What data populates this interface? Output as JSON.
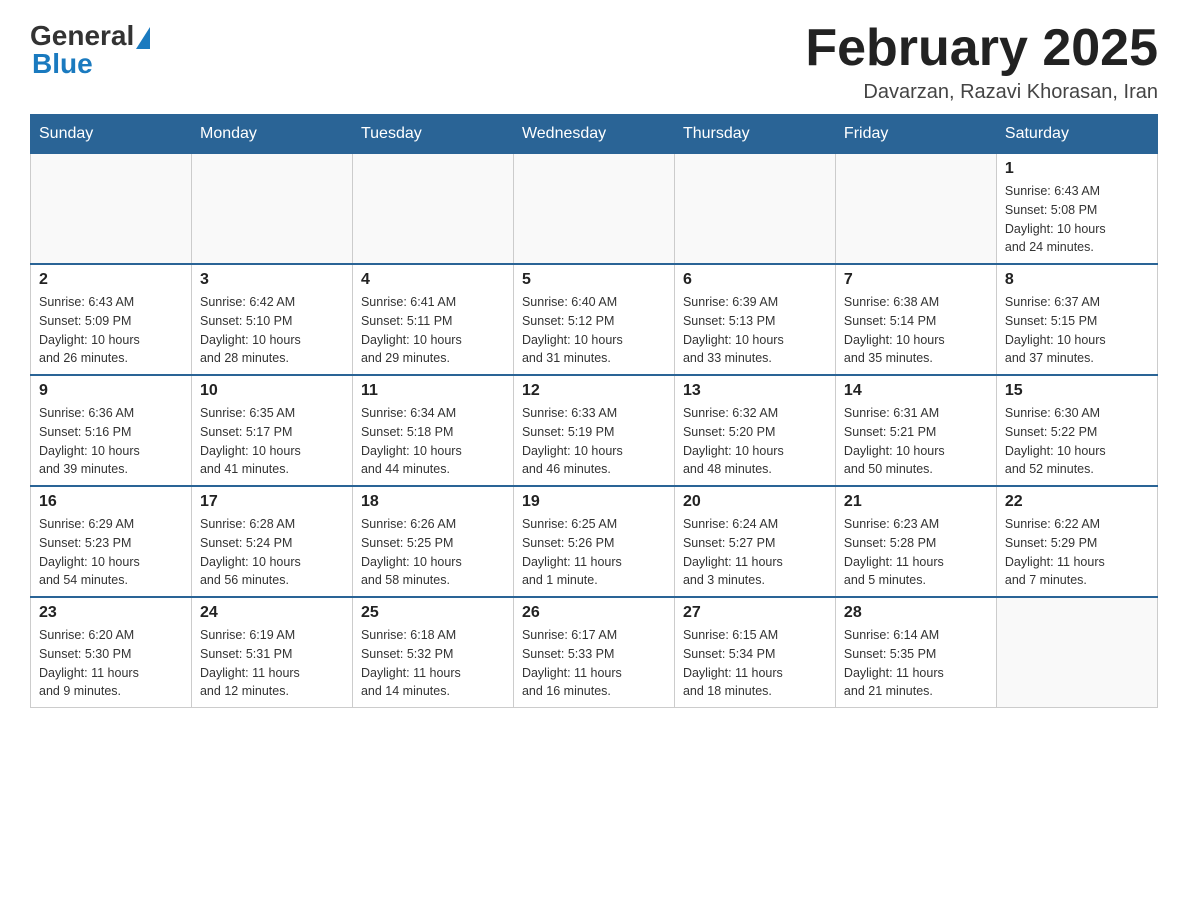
{
  "logo": {
    "general": "General",
    "blue": "Blue"
  },
  "header": {
    "title": "February 2025",
    "location": "Davarzan, Razavi Khorasan, Iran"
  },
  "weekdays": [
    "Sunday",
    "Monday",
    "Tuesday",
    "Wednesday",
    "Thursday",
    "Friday",
    "Saturday"
  ],
  "weeks": [
    [
      {
        "day": "",
        "info": ""
      },
      {
        "day": "",
        "info": ""
      },
      {
        "day": "",
        "info": ""
      },
      {
        "day": "",
        "info": ""
      },
      {
        "day": "",
        "info": ""
      },
      {
        "day": "",
        "info": ""
      },
      {
        "day": "1",
        "info": "Sunrise: 6:43 AM\nSunset: 5:08 PM\nDaylight: 10 hours\nand 24 minutes."
      }
    ],
    [
      {
        "day": "2",
        "info": "Sunrise: 6:43 AM\nSunset: 5:09 PM\nDaylight: 10 hours\nand 26 minutes."
      },
      {
        "day": "3",
        "info": "Sunrise: 6:42 AM\nSunset: 5:10 PM\nDaylight: 10 hours\nand 28 minutes."
      },
      {
        "day": "4",
        "info": "Sunrise: 6:41 AM\nSunset: 5:11 PM\nDaylight: 10 hours\nand 29 minutes."
      },
      {
        "day": "5",
        "info": "Sunrise: 6:40 AM\nSunset: 5:12 PM\nDaylight: 10 hours\nand 31 minutes."
      },
      {
        "day": "6",
        "info": "Sunrise: 6:39 AM\nSunset: 5:13 PM\nDaylight: 10 hours\nand 33 minutes."
      },
      {
        "day": "7",
        "info": "Sunrise: 6:38 AM\nSunset: 5:14 PM\nDaylight: 10 hours\nand 35 minutes."
      },
      {
        "day": "8",
        "info": "Sunrise: 6:37 AM\nSunset: 5:15 PM\nDaylight: 10 hours\nand 37 minutes."
      }
    ],
    [
      {
        "day": "9",
        "info": "Sunrise: 6:36 AM\nSunset: 5:16 PM\nDaylight: 10 hours\nand 39 minutes."
      },
      {
        "day": "10",
        "info": "Sunrise: 6:35 AM\nSunset: 5:17 PM\nDaylight: 10 hours\nand 41 minutes."
      },
      {
        "day": "11",
        "info": "Sunrise: 6:34 AM\nSunset: 5:18 PM\nDaylight: 10 hours\nand 44 minutes."
      },
      {
        "day": "12",
        "info": "Sunrise: 6:33 AM\nSunset: 5:19 PM\nDaylight: 10 hours\nand 46 minutes."
      },
      {
        "day": "13",
        "info": "Sunrise: 6:32 AM\nSunset: 5:20 PM\nDaylight: 10 hours\nand 48 minutes."
      },
      {
        "day": "14",
        "info": "Sunrise: 6:31 AM\nSunset: 5:21 PM\nDaylight: 10 hours\nand 50 minutes."
      },
      {
        "day": "15",
        "info": "Sunrise: 6:30 AM\nSunset: 5:22 PM\nDaylight: 10 hours\nand 52 minutes."
      }
    ],
    [
      {
        "day": "16",
        "info": "Sunrise: 6:29 AM\nSunset: 5:23 PM\nDaylight: 10 hours\nand 54 minutes."
      },
      {
        "day": "17",
        "info": "Sunrise: 6:28 AM\nSunset: 5:24 PM\nDaylight: 10 hours\nand 56 minutes."
      },
      {
        "day": "18",
        "info": "Sunrise: 6:26 AM\nSunset: 5:25 PM\nDaylight: 10 hours\nand 58 minutes."
      },
      {
        "day": "19",
        "info": "Sunrise: 6:25 AM\nSunset: 5:26 PM\nDaylight: 11 hours\nand 1 minute."
      },
      {
        "day": "20",
        "info": "Sunrise: 6:24 AM\nSunset: 5:27 PM\nDaylight: 11 hours\nand 3 minutes."
      },
      {
        "day": "21",
        "info": "Sunrise: 6:23 AM\nSunset: 5:28 PM\nDaylight: 11 hours\nand 5 minutes."
      },
      {
        "day": "22",
        "info": "Sunrise: 6:22 AM\nSunset: 5:29 PM\nDaylight: 11 hours\nand 7 minutes."
      }
    ],
    [
      {
        "day": "23",
        "info": "Sunrise: 6:20 AM\nSunset: 5:30 PM\nDaylight: 11 hours\nand 9 minutes."
      },
      {
        "day": "24",
        "info": "Sunrise: 6:19 AM\nSunset: 5:31 PM\nDaylight: 11 hours\nand 12 minutes."
      },
      {
        "day": "25",
        "info": "Sunrise: 6:18 AM\nSunset: 5:32 PM\nDaylight: 11 hours\nand 14 minutes."
      },
      {
        "day": "26",
        "info": "Sunrise: 6:17 AM\nSunset: 5:33 PM\nDaylight: 11 hours\nand 16 minutes."
      },
      {
        "day": "27",
        "info": "Sunrise: 6:15 AM\nSunset: 5:34 PM\nDaylight: 11 hours\nand 18 minutes."
      },
      {
        "day": "28",
        "info": "Sunrise: 6:14 AM\nSunset: 5:35 PM\nDaylight: 11 hours\nand 21 minutes."
      },
      {
        "day": "",
        "info": ""
      }
    ]
  ]
}
